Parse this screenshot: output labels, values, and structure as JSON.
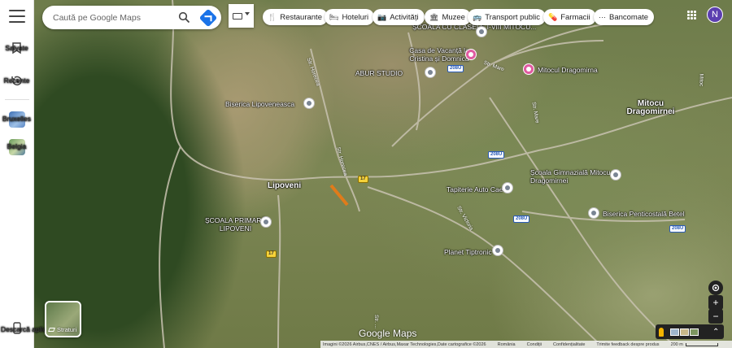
{
  "rail": {
    "menu_icon": "menu-icon",
    "items": [
      {
        "label": "Salvate",
        "icon": "bookmark-icon"
      },
      {
        "label": "Recente",
        "icon": "history-icon"
      },
      {
        "label": "Bruxelles",
        "icon": "place-thumbnail"
      },
      {
        "label": "Belgia",
        "icon": "place-thumbnail"
      }
    ],
    "download": {
      "label": "Descarcă aplicația",
      "icon": "phone-icon"
    }
  },
  "search": {
    "placeholder": "Caută pe Google Maps",
    "icons": [
      "search-icon",
      "directions-icon"
    ]
  },
  "chips": [
    {
      "label": "Restaurante",
      "icon": "restaurant-icon"
    },
    {
      "label": "Hoteluri",
      "icon": "hotel-icon"
    },
    {
      "label": "Activități",
      "icon": "camera-icon"
    },
    {
      "label": "Muzee",
      "icon": "museum-icon"
    },
    {
      "label": "Transport public",
      "icon": "bus-icon"
    },
    {
      "label": "Farmacii",
      "icon": "pharmacy-icon"
    },
    {
      "label": "Bancomate",
      "icon": "atm-icon"
    }
  ],
  "user": {
    "initial": "N",
    "color": "#5c3fb0"
  },
  "map": {
    "labels": [
      {
        "text": "ȘCOALA CU CLASELE I-VIII MITOCU..."
      },
      {
        "text": "Casa de Vacanță la Cristina și Domnica"
      },
      {
        "text": "ABUR STUDIO"
      },
      {
        "text": "Mitocul Dragomirna"
      },
      {
        "text": "Biserica Lipoveneasca"
      },
      {
        "text": "Mitocu Dragomirnei"
      },
      {
        "text": "Lipoveni"
      },
      {
        "text": "Tapiterie Auto Cae"
      },
      {
        "text": "Școala Gimnazială Mitocu Dragomirnei"
      },
      {
        "text": "Biserica Penticostală Betel"
      },
      {
        "text": "ȘCOALA PRIMARĂ LIPOVENI"
      },
      {
        "text": "Planet Tiptronic"
      }
    ],
    "streets": [
      "Str. Horecea",
      "Str. Mare",
      "Str. Mare",
      "Mitoc",
      "Str. Horecea",
      "Str. Victoria",
      "Str. ..."
    ],
    "road_shields": [
      "208U",
      "208U",
      "208U",
      "208U",
      "17",
      "17"
    ]
  },
  "layers": {
    "label": "Straturi",
    "icon": "layers-icon"
  },
  "brand": "Google Maps",
  "controls": {
    "icons": [
      "my-location-icon",
      "zoom-in-icon",
      "zoom-out-icon",
      "pegman-icon",
      "expand-icon"
    ],
    "zoom_in": "+",
    "zoom_out": "−"
  },
  "attribution": {
    "imagery": "Imagini ©2026 Airbus,CNES / Airbus,Maxar Technologies,Date cartografice ©2026",
    "country": "România",
    "terms": "Condiții",
    "privacy": "Confidențialitate",
    "feedback": "Trimite feedback despre produs",
    "scale": "200 m"
  }
}
